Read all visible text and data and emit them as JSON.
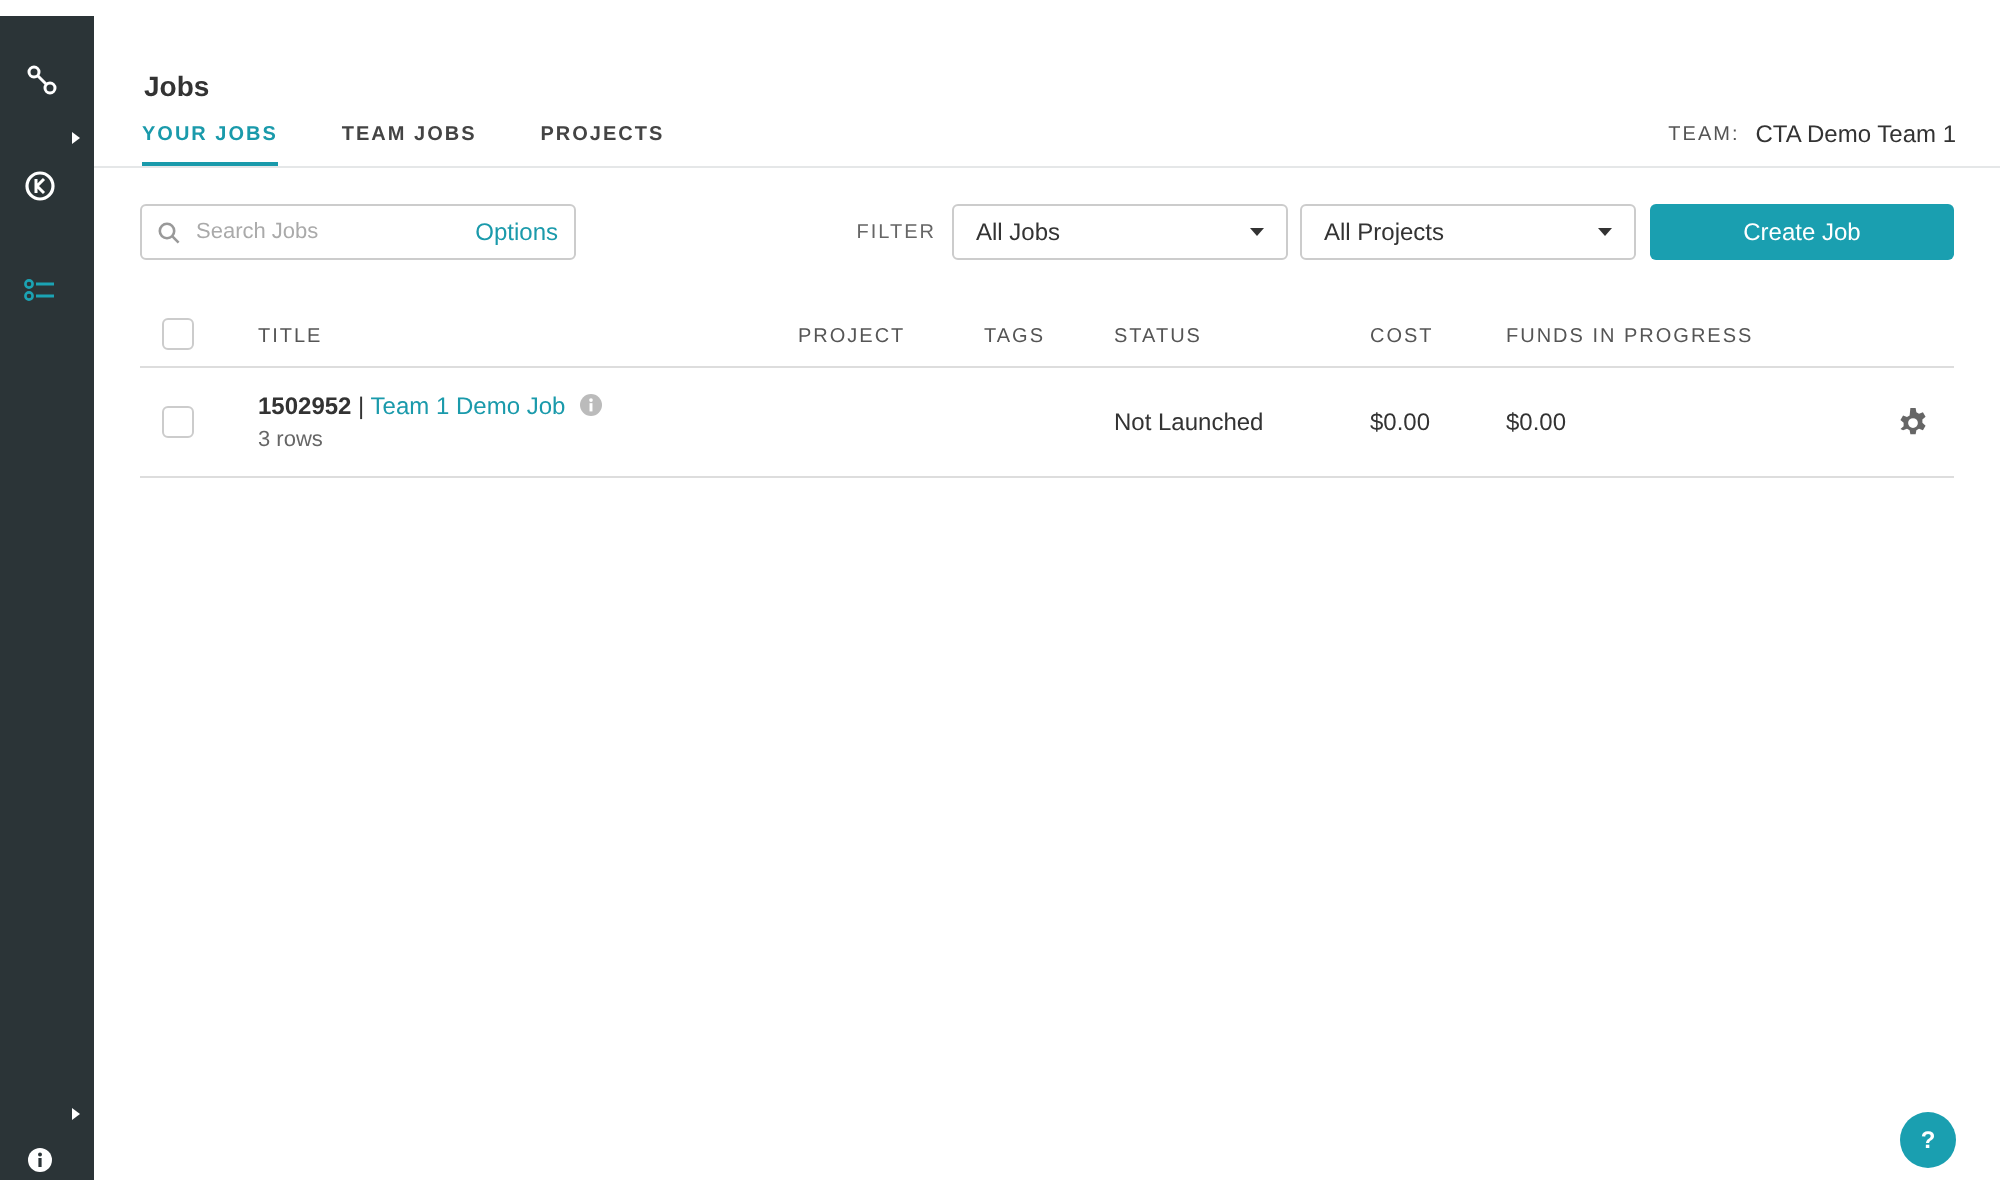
{
  "page": {
    "title": "Jobs"
  },
  "tabs": [
    {
      "label": "YOUR JOBS",
      "selected": true
    },
    {
      "label": "TEAM JOBS",
      "selected": false
    },
    {
      "label": "PROJECTS",
      "selected": false
    }
  ],
  "team": {
    "label": "TEAM:",
    "value": "CTA Demo Team 1"
  },
  "search": {
    "placeholder": "Search Jobs",
    "options_label": "Options"
  },
  "filter": {
    "label": "FILTER",
    "job_select": "All Jobs",
    "project_select": "All Projects"
  },
  "create_button": "Create Job",
  "table": {
    "columns": [
      "TITLE",
      "PROJECT",
      "TAGS",
      "STATUS",
      "COST",
      "FUNDS IN PROGRESS"
    ],
    "select_all_checked": false,
    "rows": [
      {
        "checked": false,
        "id": "1502952",
        "separator": "|",
        "name": "Team 1 Demo Job",
        "subtitle": "3 rows",
        "project": "",
        "tags": "",
        "status": "Not Launched",
        "cost": "$0.00",
        "funds": "$0.00"
      }
    ]
  },
  "help_button": "?"
}
